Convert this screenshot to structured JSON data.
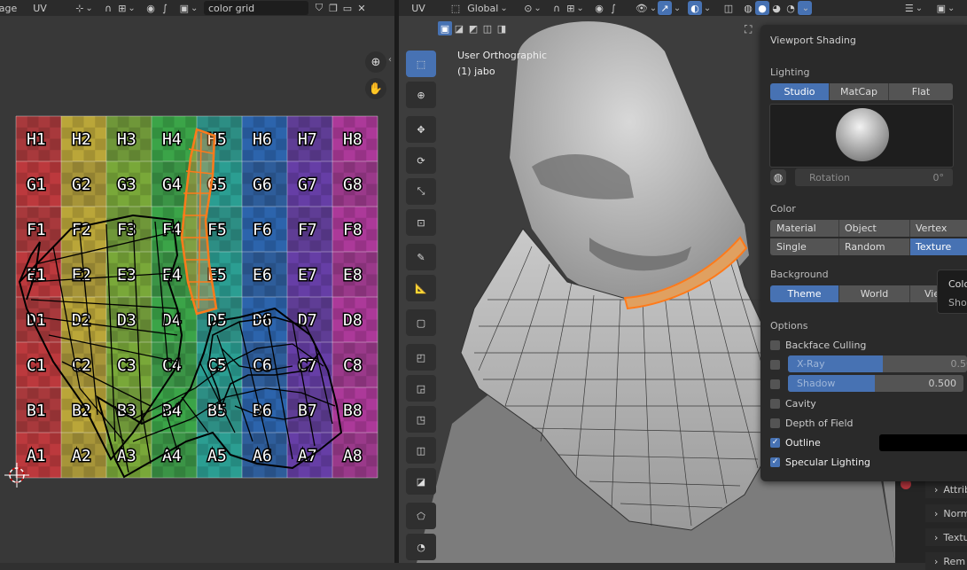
{
  "uv_header": {
    "editor_label": "age",
    "menu_uv": "UV",
    "image_name": "color grid"
  },
  "uv_grid": {
    "rows": [
      "H",
      "G",
      "F",
      "E",
      "D",
      "C",
      "B",
      "A"
    ],
    "cols": [
      "1",
      "2",
      "3",
      "4",
      "5",
      "6",
      "7",
      "8"
    ],
    "column_colors": [
      "#c83a3e",
      "#c6b03a",
      "#7fb23a",
      "#3cae4a",
      "#2aa79a",
      "#2b68b6",
      "#6a3fb0",
      "#b63aa2"
    ]
  },
  "viewport_header": {
    "menu_uv": "UV",
    "orientation": "Global"
  },
  "viewport": {
    "view_name": "User Orthographic",
    "object_name": "(1) jabo"
  },
  "shading_panel": {
    "title": "Viewport Shading",
    "lighting_label": "Lighting",
    "lighting_options": [
      "Studio",
      "MatCap",
      "Flat"
    ],
    "lighting_selected": "Studio",
    "rotation_label": "Rotation",
    "rotation_value": "0°",
    "color_label": "Color",
    "color_options": [
      "Material",
      "Object",
      "Vertex",
      "Single",
      "Random",
      "Texture"
    ],
    "color_selected": "Texture",
    "background_label": "Background",
    "background_options": [
      "Theme",
      "World",
      "Vie"
    ],
    "background_selected": "Theme",
    "options_label": "Options",
    "backface_culling": {
      "label": "Backface Culling",
      "checked": false
    },
    "xray": {
      "label": "X-Ray",
      "value": "0.50",
      "fill": 0.5
    },
    "shadow": {
      "label": "Shadow",
      "value": "0.500",
      "fill": 0.5
    },
    "cavity": {
      "label": "Cavity",
      "checked": false
    },
    "depth_of_field": {
      "label": "Depth of Field",
      "checked": false
    },
    "outline": {
      "label": "Outline",
      "checked": true
    },
    "specular_lighting": {
      "label": "Specular Lighting",
      "checked": true
    }
  },
  "tooltip": {
    "line1": "Colo",
    "line2": "Show"
  },
  "properties_items": [
    "Attrib",
    "Norm",
    "Textu",
    "Rem"
  ],
  "colors": {
    "accent": "#4772b3",
    "selection": "#ff7a1a"
  }
}
